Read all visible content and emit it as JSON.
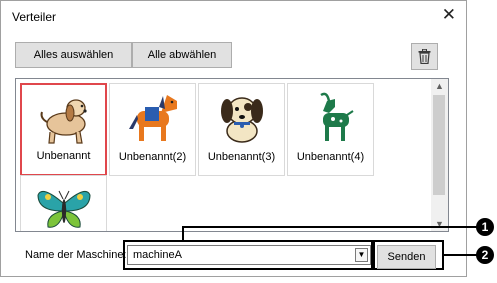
{
  "window": {
    "title": "Verteiler",
    "close_glyph": "✕"
  },
  "toolbar": {
    "select_all_label": "Alles auswählen",
    "deselect_all_label": "Alle abwählen",
    "trash_icon": "trash-icon"
  },
  "designs": [
    {
      "label": "Unbenannt",
      "icon": "spaniel-dog-icon",
      "selected": true
    },
    {
      "label": "Unbenannt(2)",
      "icon": "horse-icon",
      "selected": false
    },
    {
      "label": "Unbenannt(3)",
      "icon": "puppy-icon",
      "selected": false
    },
    {
      "label": "Unbenannt(4)",
      "icon": "goat-icon",
      "selected": false
    },
    {
      "label": "",
      "icon": "butterfly-icon",
      "selected": false
    }
  ],
  "machine": {
    "label": "Name der Maschine:",
    "value": "machineA",
    "send_label": "Senden"
  },
  "callouts": [
    "1",
    "2"
  ],
  "colors": {
    "selection_border": "#e0474c",
    "highlight": "#000000"
  }
}
